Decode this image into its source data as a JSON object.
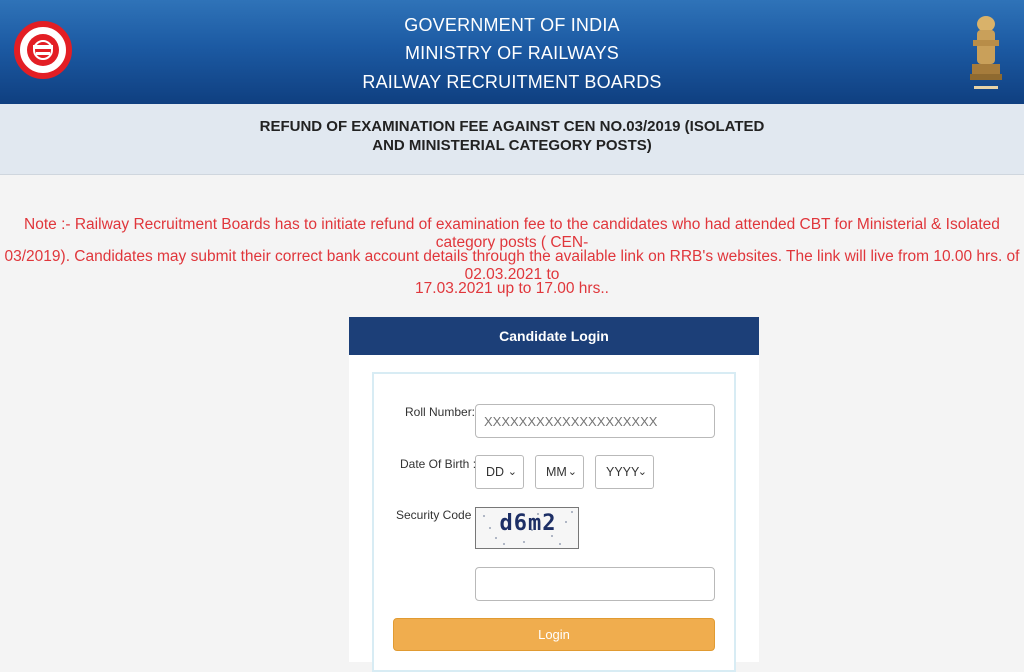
{
  "header": {
    "line1": "GOVERNMENT OF INDIA",
    "line2": "MINISTRY OF RAILWAYS",
    "line3": "RAILWAY RECRUITMENT BOARDS",
    "logo_left": "indian-railways-logo",
    "logo_right": "national-emblem",
    "logo_left_text": "भारतीय रेल • INDIAN RAILWAYS",
    "emblem_text": "सत्यमेव जयते"
  },
  "title": {
    "line1": "REFUND OF EXAMINATION FEE AGAINST CEN NO.03/2019 (ISOLATED",
    "line2": "AND MINISTERIAL CATEGORY POSTS)"
  },
  "note": {
    "line1": "Note :- Railway Recruitment Boards has to initiate refund of examination fee to the candidates who had attended CBT for Ministerial & Isolated category posts ( CEN-",
    "line2": "03/2019). Candidates may submit their correct bank account details through the available link on RRB's websites. The link will live from 10.00 hrs. of 02.03.2021 to",
    "line3": "17.03.2021 up to 17.00 hrs.."
  },
  "login": {
    "heading": "Candidate Login",
    "roll_label": "Roll Number:",
    "roll_placeholder": "XXXXXXXXXXXXXXXXXXXX",
    "dob_label": "Date Of Birth :",
    "dob_day": "DD",
    "dob_month": "MM",
    "dob_year": "YYYY",
    "security_label": "Security Code :",
    "captcha_text": "d6m2",
    "security_value": "",
    "button": "Login",
    "required_mark": "*"
  },
  "colors": {
    "header_blue": "#1c5aa3",
    "note_red": "#e0363b",
    "card_navy": "#1c3f78",
    "button_orange": "#f0ad4e"
  }
}
